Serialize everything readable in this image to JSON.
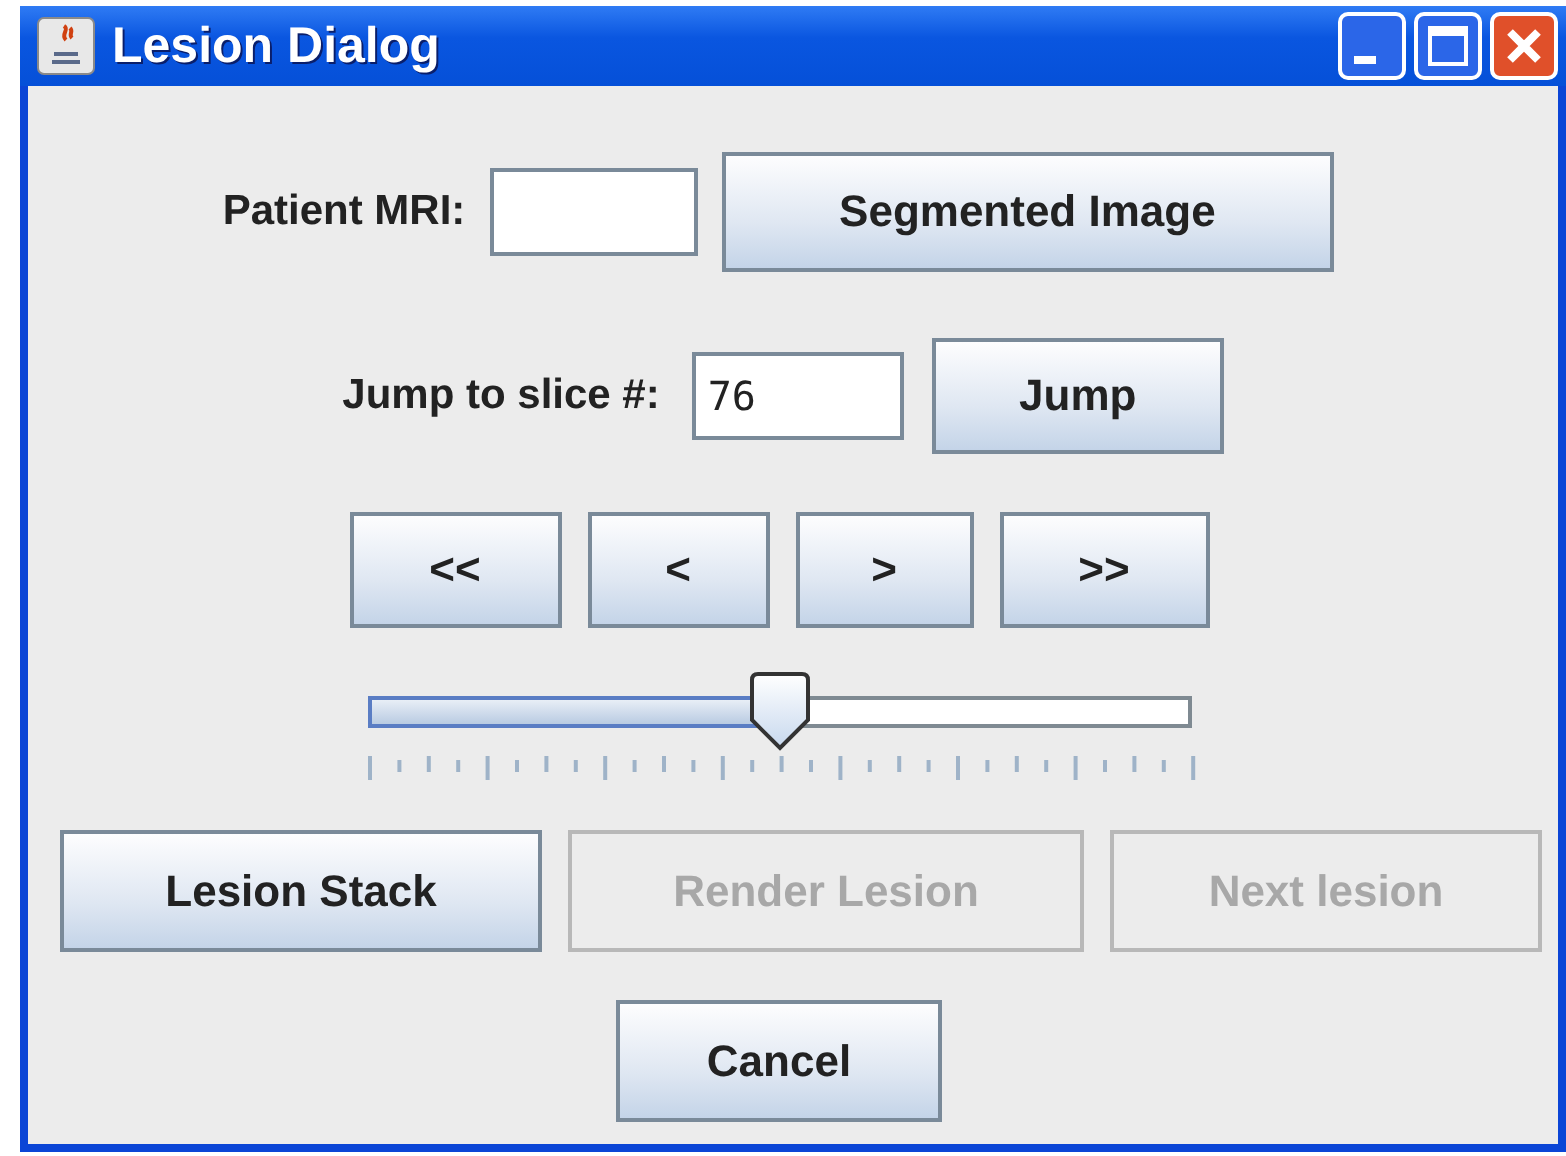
{
  "window": {
    "title": "Lesion Dialog"
  },
  "patient_mri": {
    "label": "Patient MRI:"
  },
  "segmented_button": {
    "label": "Segmented Image",
    "disabled": false
  },
  "jump": {
    "label": "Jump to slice #:",
    "value": "76",
    "button": {
      "label": "Jump",
      "disabled": false
    }
  },
  "nav_buttons": [
    {
      "label": "<<",
      "disabled": false
    },
    {
      "label": "<",
      "disabled": false
    },
    {
      "label": ">",
      "disabled": false
    },
    {
      "label": ">>",
      "disabled": false
    }
  ],
  "slider": {
    "level": 0.5
  },
  "action_buttons": [
    {
      "label": "Lesion Stack",
      "disabled": false
    },
    {
      "label": "Render Lesion",
      "disabled": true
    },
    {
      "label": "Next lesion",
      "disabled": true
    }
  ],
  "cancel_button": {
    "label": "Cancel",
    "disabled": false
  }
}
